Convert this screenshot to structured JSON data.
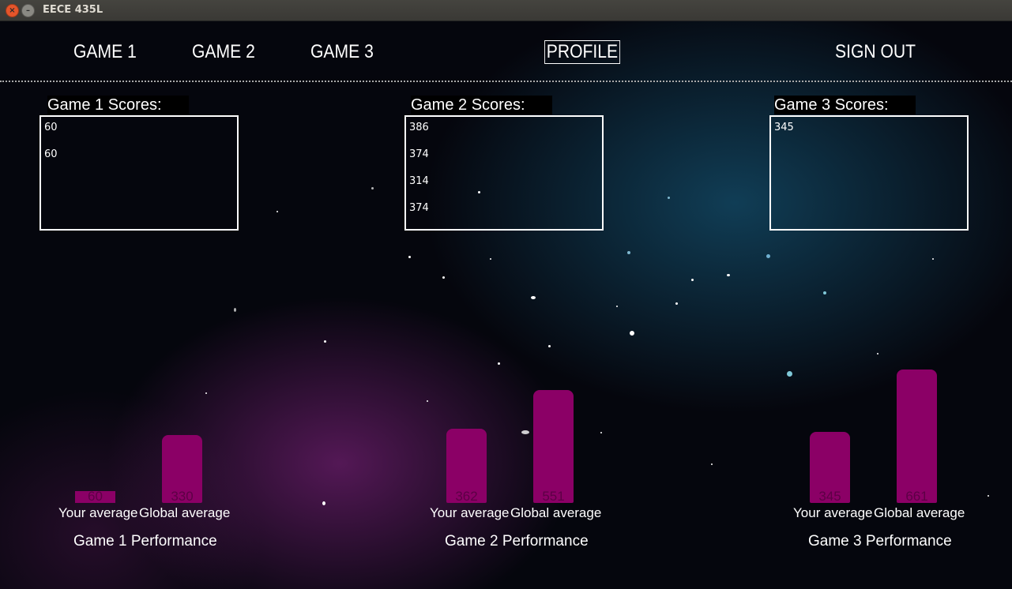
{
  "window": {
    "title": "EECE 435L"
  },
  "nav": {
    "game1": "GAME 1",
    "game2": "GAME 2",
    "game3": "GAME 3",
    "profile": "PROFILE",
    "sign_out": "SIGN OUT"
  },
  "scores": [
    {
      "title": "Game 1 Scores:",
      "values": [
        "60",
        "60"
      ]
    },
    {
      "title": "Game 2 Scores:",
      "values": [
        "386",
        "374",
        "314",
        "374"
      ]
    },
    {
      "title": "Game 3 Scores:",
      "values": [
        "345"
      ]
    }
  ],
  "performance": [
    {
      "title": "Game 1 Performance",
      "your_label": "Your average",
      "global_label": "Global average",
      "your_value": "60",
      "global_value": "330"
    },
    {
      "title": "Game 2 Performance",
      "your_label": "Your average",
      "global_label": "Global average",
      "your_value": "362",
      "global_value": "551"
    },
    {
      "title": "Game 3 Performance",
      "your_label": "Your average",
      "global_label": "Global average",
      "your_value": "345",
      "global_value": "661"
    }
  ],
  "colors": {
    "bar": "#8b0066",
    "text": "#ffffff"
  }
}
